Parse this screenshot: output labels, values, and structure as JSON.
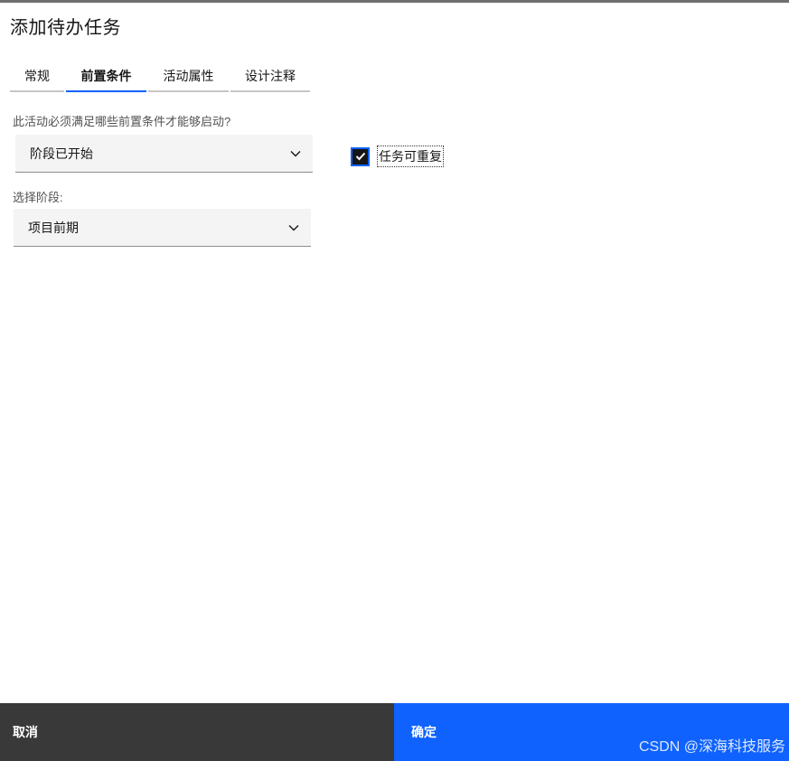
{
  "dialog": {
    "title": "添加待办任务"
  },
  "tabs": [
    {
      "label": "常规",
      "active": false
    },
    {
      "label": "前置条件",
      "active": true
    },
    {
      "label": "活动属性",
      "active": false
    },
    {
      "label": "设计注释",
      "active": false
    }
  ],
  "form": {
    "precondition_label": "此活动必须满足哪些前置条件才能够启动?",
    "precondition_value": "阶段已开始",
    "stage_label": "选择阶段:",
    "stage_value": "项目前期",
    "repeatable_label": "任务可重复",
    "repeatable_checked": true
  },
  "footer": {
    "cancel_label": "取消",
    "ok_label": "确定",
    "watermark": "CSDN @深海科技服务"
  },
  "colors": {
    "primary": "#0f62fe",
    "cancel_bg": "#393939",
    "field_bg": "#f4f4f4"
  },
  "icons": {
    "select_chevron": "chevron-down-icon",
    "checkbox_mark": "checkmark-icon"
  }
}
